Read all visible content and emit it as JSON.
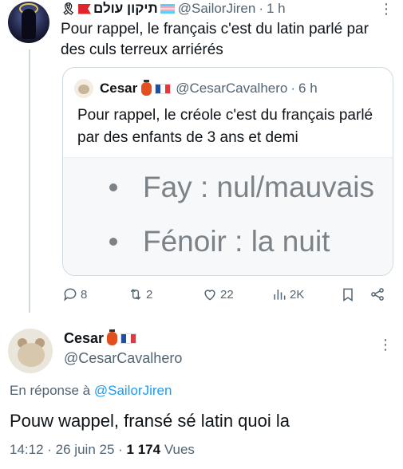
{
  "first_tweet": {
    "display_name": "תיקון עולם",
    "handle": "@SailorJiren",
    "time": "1 h",
    "text": "Pour rappel, le français c'est du latin parlé par des culs terreux arriérés"
  },
  "quoted_tweet": {
    "display_name": "Cesar",
    "handle": "@CesarCavalhero",
    "time": "6 h",
    "text": "Pour rappel, le créole c'est du français parlé par des enfants de 3 ans et demi",
    "media_lines": [
      "Fay : nul/mauvais",
      "Fénoir : la nuit"
    ]
  },
  "actions": {
    "replies": "8",
    "retweets": "2",
    "likes": "22",
    "views": "2K"
  },
  "main_tweet": {
    "display_name": "Cesar",
    "handle": "@CesarCavalhero",
    "replying_prefix": "En réponse à ",
    "replying_to": "@SailorJiren",
    "text": "Pouw wappel, fransé sé latin quoi la",
    "time": "14:12",
    "date": "26 juin 25",
    "views_count": "1 174",
    "views_label": "Vues"
  },
  "colors": {
    "text": "#0f1419",
    "secondary": "#536471",
    "link": "#1d9bf0",
    "border": "#cfd9de"
  }
}
